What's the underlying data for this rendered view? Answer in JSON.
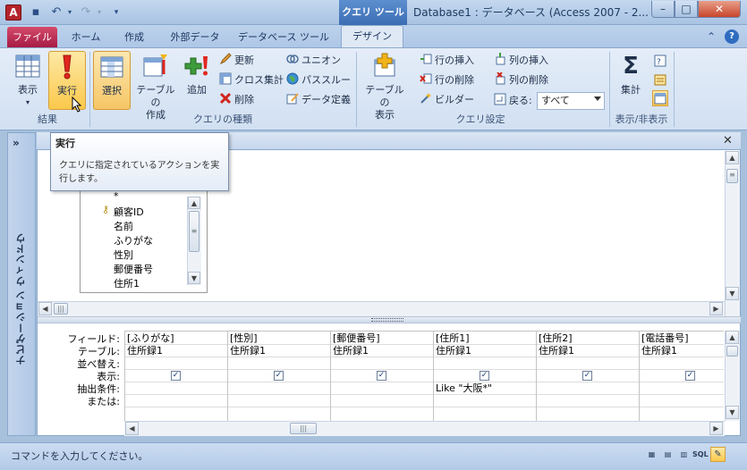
{
  "window": {
    "title": "Database1 : データベース (Access 2007 - 2...",
    "context_tab": "クエリ ツール",
    "app_icon_letter": "A",
    "minimize": "–",
    "maximize": "□",
    "close": "✕"
  },
  "ribbon_tabs": [
    "ファイル",
    "ホーム",
    "作成",
    "外部データ",
    "データベース ツール",
    "デザイン"
  ],
  "ribbon": {
    "groups": {
      "results": "結果",
      "query_type": "クエリの種類",
      "query_setup": "クエリ設定",
      "show_hide": "表示/非表示"
    },
    "buttons": {
      "view": "表示",
      "run": "実行",
      "select": "選択",
      "make_table_1": "テーブルの",
      "make_table_2": "作成",
      "append": "追加",
      "update": "更新",
      "crosstab": "クロス集計",
      "delete": "削除",
      "union": "ユニオン",
      "passthrough": "パススルー",
      "data_definition": "データ定義",
      "show_table_1": "テーブルの",
      "show_table_2": "表示",
      "insert_rows": "行の挿入",
      "delete_rows": "行の削除",
      "builder": "ビルダー",
      "insert_columns": "列の挿入",
      "delete_columns": "列の削除",
      "return_label": "戻る:",
      "return_value": "すべて",
      "totals": "集計"
    }
  },
  "nav_pane": {
    "toggle": "»",
    "label": "ナビゲーション ウィンドウ"
  },
  "table_box": {
    "fields": [
      "*",
      "顧客ID",
      "名前",
      "ふりがな",
      "性別",
      "郵便番号",
      "住所1"
    ]
  },
  "grid": {
    "row_headers": [
      "フィールド:",
      "テーブル:",
      "並べ替え:",
      "表示:",
      "抽出条件:",
      "または:"
    ],
    "columns": [
      {
        "field": "[ふりがな]",
        "table": "住所録1",
        "show": true,
        "criteria": ""
      },
      {
        "field": "[性別]",
        "table": "住所録1",
        "show": true,
        "criteria": ""
      },
      {
        "field": "[郵便番号]",
        "table": "住所録1",
        "show": true,
        "criteria": ""
      },
      {
        "field": "[住所1]",
        "table": "住所録1",
        "show": true,
        "criteria": "Like \"大阪*\""
      },
      {
        "field": "[住所2]",
        "table": "住所録1",
        "show": true,
        "criteria": ""
      },
      {
        "field": "[電話番号]",
        "table": "住所録1",
        "show": true,
        "criteria": ""
      }
    ]
  },
  "tooltip": {
    "title": "実行",
    "body": "クエリに指定されているアクションを実行します。"
  },
  "status": {
    "text": "コマンドを入力してください。",
    "sql_label": "SQL"
  },
  "colors": {
    "file_tab": "#b8234a",
    "context_tab": "#4a7cc0",
    "run_button": "#fbc84b"
  }
}
